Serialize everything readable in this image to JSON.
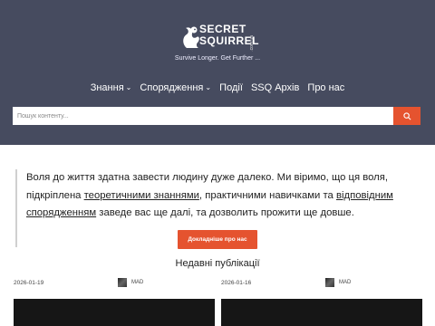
{
  "header": {
    "logo": {
      "line1": "SECRET",
      "line2": "SQUIRREL",
      "sub": ".com.ua"
    },
    "tagline": "Survive Longer. Get Further ...",
    "nav": [
      {
        "label": "Знання",
        "has_dropdown": true
      },
      {
        "label": "Спорядження",
        "has_dropdown": true
      },
      {
        "label": "Події",
        "has_dropdown": false
      },
      {
        "label": "SSQ Архів",
        "has_dropdown": false
      },
      {
        "label": "Про нас",
        "has_dropdown": false
      }
    ],
    "search": {
      "placeholder": "Пошук контенту...",
      "icon": "search-icon"
    },
    "colors": {
      "background": "#464b5f",
      "accent": "#e5532f"
    }
  },
  "intro": {
    "text_1": "Воля до життя здатна завести людину дуже далеко. Ми віримо, що ця воля, підкріплена ",
    "link_1": "теоретичними знаннями",
    "text_2": ", практичними навичками та ",
    "link_2": "відповідним спорядженням",
    "text_3": " заведе вас ще далі, та дозволить прожити ще довше."
  },
  "cta": {
    "label": "Докладніше про нас"
  },
  "recent": {
    "title": "Недавні публікації",
    "posts": [
      {
        "date": "2026-01-19",
        "author": "MAD"
      },
      {
        "date": "2026-01-16",
        "author": "MAD"
      }
    ]
  }
}
